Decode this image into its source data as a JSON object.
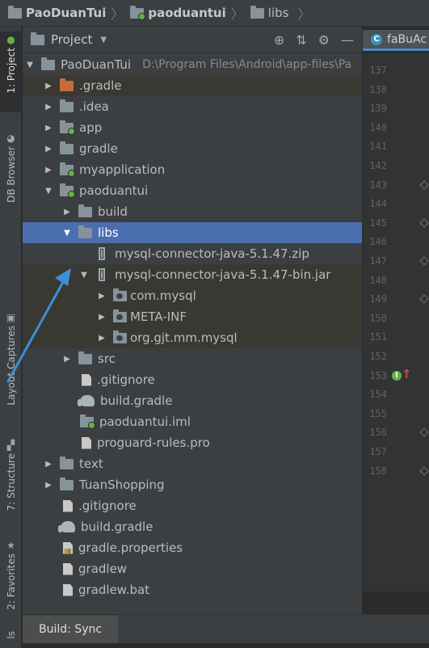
{
  "breadcrumbs": [
    {
      "label": "PaoDuanTui",
      "icon": "folder-icon"
    },
    {
      "label": "paoduantui",
      "icon": "module-folder-icon"
    },
    {
      "label": "libs",
      "icon": "folder-icon"
    }
  ],
  "left_strip": {
    "project_tab": "1: Project",
    "db_tab": "DB Browser",
    "layout_tab": "Layout Captures",
    "structure_tab": "7: Structure",
    "favorites_tab": "2: Favorites",
    "extra_tab": "ls"
  },
  "panel": {
    "title": "Project",
    "view_caret": "▼"
  },
  "tree": [
    {
      "label": "PaoDuanTui",
      "path": "D:\\Program Files\\Android\\app-files\\Pa"
    },
    {
      "label": ".gradle"
    },
    {
      "label": ".idea"
    },
    {
      "label": "app"
    },
    {
      "label": "gradle"
    },
    {
      "label": "myapplication"
    },
    {
      "label": "paoduantui"
    },
    {
      "label": "build"
    },
    {
      "label": "libs"
    },
    {
      "label": "mysql-connector-java-5.1.47.zip"
    },
    {
      "label": "mysql-connector-java-5.1.47-bin.jar"
    },
    {
      "label": "com.mysql"
    },
    {
      "label": "META-INF"
    },
    {
      "label": "org.gjt.mm.mysql"
    },
    {
      "label": "src"
    },
    {
      "label": ".gitignore"
    },
    {
      "label": "build.gradle"
    },
    {
      "label": "paoduantui.iml"
    },
    {
      "label": "proguard-rules.pro"
    },
    {
      "label": "text"
    },
    {
      "label": "TuanShopping"
    },
    {
      "label": ".gitignore"
    },
    {
      "label": "build.gradle"
    },
    {
      "label": "gradle.properties"
    },
    {
      "label": "gradlew"
    },
    {
      "label": "gradlew.bat"
    }
  ],
  "editor": {
    "tab_label": "faBuAc",
    "line_numbers": [
      "137",
      "138",
      "139",
      "140",
      "141",
      "142",
      "143",
      "144",
      "145",
      "146",
      "147",
      "148",
      "149",
      "150",
      "151",
      "152",
      "153",
      "154",
      "155",
      "156",
      "157",
      "158"
    ]
  },
  "bottom": {
    "build_tab": "Build: Sync"
  },
  "colors": {
    "selection": "#4b6eaf",
    "panel_bg": "#3c3f41",
    "editor_bg": "#2b2b2b",
    "annotation_arrow": "#3d8fd9"
  }
}
